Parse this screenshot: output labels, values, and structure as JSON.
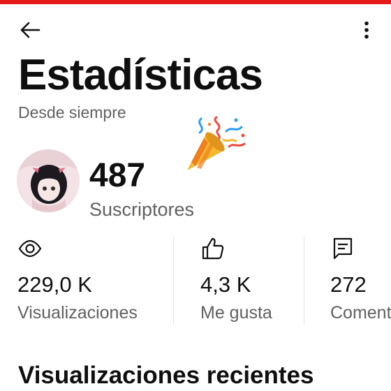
{
  "status_strip": {
    "text": ""
  },
  "header": {
    "back_icon": "arrow-left-icon",
    "more_icon": "vertical-dots-icon",
    "title": "Estadísticas",
    "subtitle": "Desde siempre"
  },
  "subscribers": {
    "count": "487",
    "label": "Suscriptores"
  },
  "stats": [
    {
      "icon": "eye-icon",
      "value": "229,0 K",
      "label": "Visualizaciones"
    },
    {
      "icon": "thumbs-up-icon",
      "value": "4,3 K",
      "label": "Me gusta"
    },
    {
      "icon": "comment-icon",
      "value": "272",
      "label": "Comentarios"
    }
  ],
  "recent_section": {
    "title": "Visualizaciones recientes"
  },
  "colors": {
    "brand_red": "#e31b1b",
    "text_primary": "#0f0f0f",
    "text_secondary": "#606060",
    "divider": "#e3e3e3"
  }
}
